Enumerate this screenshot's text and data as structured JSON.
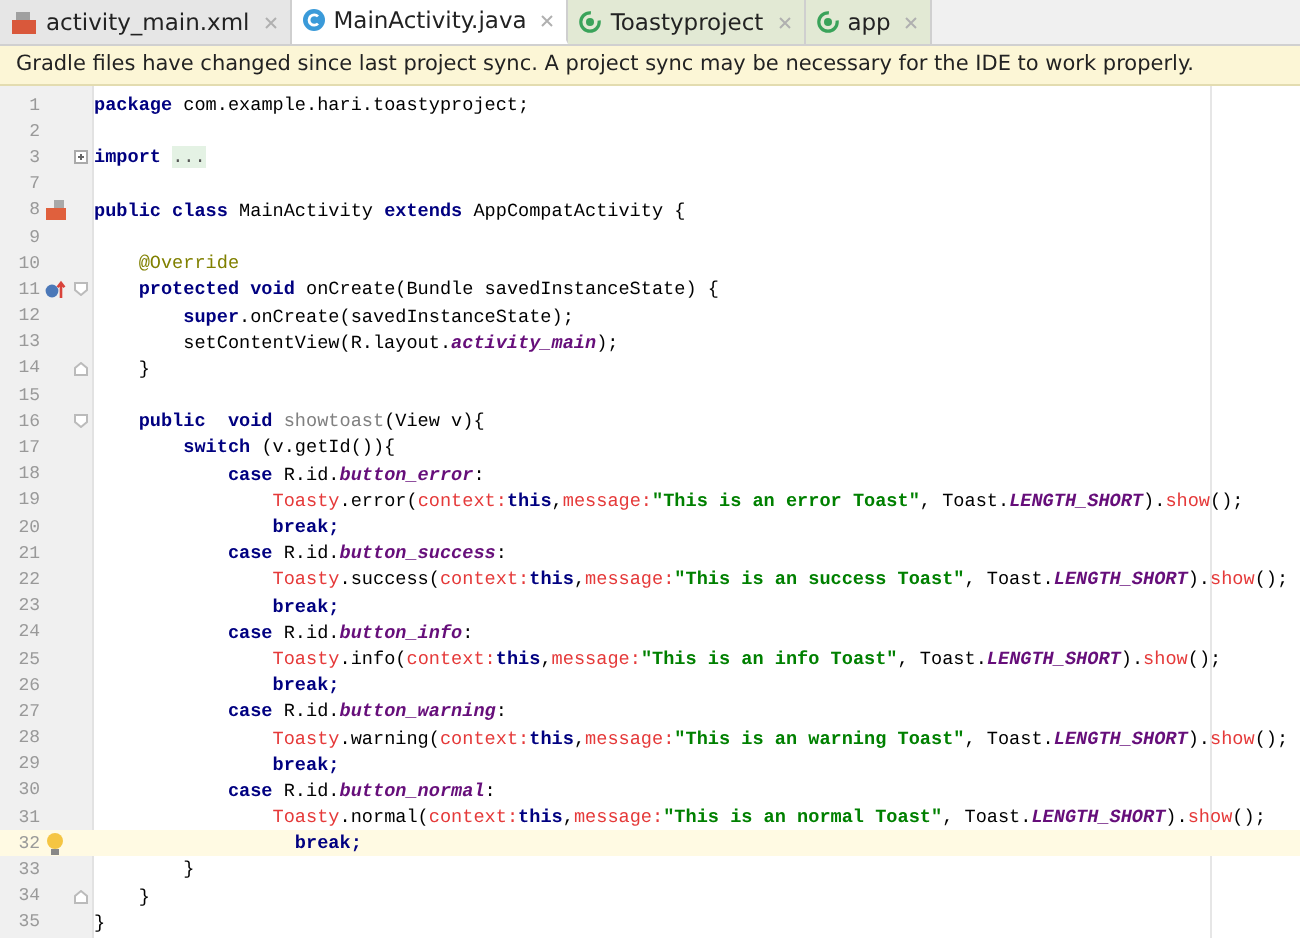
{
  "tabs": [
    {
      "label": "activity_main.xml",
      "kind": "layout",
      "selected": false,
      "color": "#e6e6e6"
    },
    {
      "label": "MainActivity.java",
      "kind": "class",
      "selected": true,
      "color": "#ffffff"
    },
    {
      "label": "Toastyproject",
      "kind": "module",
      "selected": false,
      "color": "#e2e9d4"
    },
    {
      "label": "app",
      "kind": "module",
      "selected": false,
      "color": "#e2e9d4"
    }
  ],
  "banner": {
    "message": "Gradle files have changed since last project sync. A project sync may be necessary for the IDE to work properly."
  },
  "editor": {
    "lines": [
      {
        "number": "1",
        "kind": "plain",
        "tokens": [
          {
            "kind": "kw",
            "text": "package"
          },
          {
            "kind": "text",
            "text": " com.example.hari.toastyproject;"
          }
        ]
      },
      {
        "number": "2",
        "kind": "plain"
      },
      {
        "number": "3",
        "kind": "folded",
        "tokens": [
          {
            "kind": "kw",
            "text": "import "
          },
          {
            "kind": "folded",
            "text": "..."
          }
        ]
      },
      {
        "number": "7",
        "kind": "plain"
      },
      {
        "number": "8",
        "kind": "class",
        "tokens": [
          {
            "kind": "kw",
            "text": "public class"
          },
          {
            "kind": "text",
            "text": " MainActivity "
          },
          {
            "kind": "kw",
            "text": "extends"
          },
          {
            "kind": "text",
            "text": " AppCompatActivity {"
          }
        ]
      },
      {
        "number": "9",
        "kind": "plain"
      },
      {
        "number": "10",
        "kind": "plain",
        "tokens": [
          {
            "kind": "ann",
            "text": "    @Override"
          }
        ]
      },
      {
        "number": "11",
        "kind": "override-fold-start",
        "tokens": [
          {
            "kind": "kw",
            "text": "    protected void"
          },
          {
            "kind": "text",
            "text": " onCreate(Bundle savedInstanceState) {"
          }
        ]
      },
      {
        "number": "12",
        "kind": "plain",
        "tokens": [
          {
            "kind": "kw",
            "text": "        super"
          },
          {
            "kind": "text",
            "text": ".onCreate(savedInstanceState);"
          }
        ]
      },
      {
        "number": "13",
        "kind": "plain",
        "tokens": [
          {
            "kind": "text",
            "text": "        setContentView(R.layout."
          },
          {
            "kind": "const",
            "text": "activity_main"
          },
          {
            "kind": "text",
            "text": ");"
          }
        ]
      },
      {
        "number": "14",
        "kind": "fold-end",
        "tokens": [
          {
            "kind": "text",
            "text": "    }"
          }
        ]
      },
      {
        "number": "15",
        "kind": "plain"
      },
      {
        "number": "16",
        "kind": "fold-start",
        "tokens": [
          {
            "kind": "kw",
            "text": "    public  void "
          },
          {
            "kind": "unused",
            "text": "showtoast"
          },
          {
            "kind": "text",
            "text": "(View v){"
          }
        ]
      },
      {
        "number": "17",
        "kind": "plain",
        "tokens": [
          {
            "kind": "kw",
            "text": "        switch"
          },
          {
            "kind": "text",
            "text": " (v.getId()){"
          }
        ]
      },
      {
        "number": "18",
        "kind": "plain",
        "tokens": [
          {
            "kind": "kw",
            "text": "            case"
          },
          {
            "kind": "text",
            "text": " R.id."
          },
          {
            "kind": "const",
            "text": "button_error"
          },
          {
            "kind": "text",
            "text": ":"
          }
        ]
      },
      {
        "number": "19",
        "kind": "plain",
        "tokens": [
          {
            "kind": "red",
            "text": "                Toasty"
          },
          {
            "kind": "text",
            "text": ".error("
          },
          {
            "kind": "red",
            "text": "context:"
          },
          {
            "kind": "kw",
            "text": "this"
          },
          {
            "kind": "text",
            "text": ","
          },
          {
            "kind": "red",
            "text": "message:"
          },
          {
            "kind": "str",
            "text": "\"This is an error Toast\""
          },
          {
            "kind": "text",
            "text": ", Toast."
          },
          {
            "kind": "const",
            "text": "LENGTH_SHORT"
          },
          {
            "kind": "text",
            "text": ")."
          },
          {
            "kind": "red",
            "text": "show"
          },
          {
            "kind": "text",
            "text": "();"
          }
        ]
      },
      {
        "number": "20",
        "kind": "plain",
        "tokens": [
          {
            "kind": "kw",
            "text": "                break;"
          }
        ]
      },
      {
        "number": "21",
        "kind": "plain",
        "tokens": [
          {
            "kind": "kw",
            "text": "            case"
          },
          {
            "kind": "text",
            "text": " R.id."
          },
          {
            "kind": "const",
            "text": "button_success"
          },
          {
            "kind": "text",
            "text": ":"
          }
        ]
      },
      {
        "number": "22",
        "kind": "plain",
        "tokens": [
          {
            "kind": "red",
            "text": "                Toasty"
          },
          {
            "kind": "text",
            "text": ".success("
          },
          {
            "kind": "red",
            "text": "context:"
          },
          {
            "kind": "kw",
            "text": "this"
          },
          {
            "kind": "text",
            "text": ","
          },
          {
            "kind": "red",
            "text": "message:"
          },
          {
            "kind": "str",
            "text": "\"This is an success Toast\""
          },
          {
            "kind": "text",
            "text": ", Toast."
          },
          {
            "kind": "const",
            "text": "LENGTH_SHORT"
          },
          {
            "kind": "text",
            "text": ")."
          },
          {
            "kind": "red",
            "text": "show"
          },
          {
            "kind": "text",
            "text": "();"
          }
        ]
      },
      {
        "number": "23",
        "kind": "plain",
        "tokens": [
          {
            "kind": "kw",
            "text": "                break;"
          }
        ]
      },
      {
        "number": "24",
        "kind": "plain",
        "tokens": [
          {
            "kind": "kw",
            "text": "            case"
          },
          {
            "kind": "text",
            "text": " R.id."
          },
          {
            "kind": "const",
            "text": "button_info"
          },
          {
            "kind": "text",
            "text": ":"
          }
        ]
      },
      {
        "number": "25",
        "kind": "plain",
        "tokens": [
          {
            "kind": "red",
            "text": "                Toasty"
          },
          {
            "kind": "text",
            "text": ".info("
          },
          {
            "kind": "red",
            "text": "context:"
          },
          {
            "kind": "kw",
            "text": "this"
          },
          {
            "kind": "text",
            "text": ","
          },
          {
            "kind": "red",
            "text": "message:"
          },
          {
            "kind": "str",
            "text": "\"This is an info Toast\""
          },
          {
            "kind": "text",
            "text": ", Toast."
          },
          {
            "kind": "const",
            "text": "LENGTH_SHORT"
          },
          {
            "kind": "text",
            "text": ")."
          },
          {
            "kind": "red",
            "text": "show"
          },
          {
            "kind": "text",
            "text": "();"
          }
        ]
      },
      {
        "number": "26",
        "kind": "plain",
        "tokens": [
          {
            "kind": "kw",
            "text": "                break;"
          }
        ]
      },
      {
        "number": "27",
        "kind": "plain",
        "tokens": [
          {
            "kind": "kw",
            "text": "            case"
          },
          {
            "kind": "text",
            "text": " R.id."
          },
          {
            "kind": "const",
            "text": "button_warning"
          },
          {
            "kind": "text",
            "text": ":"
          }
        ]
      },
      {
        "number": "28",
        "kind": "plain",
        "tokens": [
          {
            "kind": "red",
            "text": "                Toasty"
          },
          {
            "kind": "text",
            "text": ".warning("
          },
          {
            "kind": "red",
            "text": "context:"
          },
          {
            "kind": "kw",
            "text": "this"
          },
          {
            "kind": "text",
            "text": ","
          },
          {
            "kind": "red",
            "text": "message:"
          },
          {
            "kind": "str",
            "text": "\"This is an warning Toast\""
          },
          {
            "kind": "text",
            "text": ", Toast."
          },
          {
            "kind": "const",
            "text": "LENGTH_SHORT"
          },
          {
            "kind": "text",
            "text": ")."
          },
          {
            "kind": "red",
            "text": "show"
          },
          {
            "kind": "text",
            "text": "();"
          }
        ]
      },
      {
        "number": "29",
        "kind": "plain",
        "tokens": [
          {
            "kind": "kw",
            "text": "                break;"
          }
        ]
      },
      {
        "number": "30",
        "kind": "plain",
        "tokens": [
          {
            "kind": "kw",
            "text": "            case"
          },
          {
            "kind": "text",
            "text": " R.id."
          },
          {
            "kind": "const",
            "text": "button_normal"
          },
          {
            "kind": "text",
            "text": ":"
          }
        ]
      },
      {
        "number": "31",
        "kind": "plain",
        "tokens": [
          {
            "kind": "red",
            "text": "                Toasty"
          },
          {
            "kind": "text",
            "text": ".normal("
          },
          {
            "kind": "red",
            "text": "context:"
          },
          {
            "kind": "kw",
            "text": "this"
          },
          {
            "kind": "text",
            "text": ","
          },
          {
            "kind": "red",
            "text": "message:"
          },
          {
            "kind": "str",
            "text": "\"This is an normal Toast\""
          },
          {
            "kind": "text",
            "text": ", Toast."
          },
          {
            "kind": "const",
            "text": "LENGTH_SHORT"
          },
          {
            "kind": "text",
            "text": ")."
          },
          {
            "kind": "red",
            "text": "show"
          },
          {
            "kind": "text",
            "text": "();"
          }
        ]
      },
      {
        "number": "32",
        "kind": "current",
        "tokens": [
          {
            "kind": "kw",
            "text": "                  break;"
          }
        ]
      },
      {
        "number": "33",
        "kind": "plain",
        "tokens": [
          {
            "kind": "text",
            "text": "        }"
          }
        ]
      },
      {
        "number": "34",
        "kind": "fold-end",
        "tokens": [
          {
            "kind": "text",
            "text": "    }"
          }
        ]
      },
      {
        "number": "35",
        "kind": "plain",
        "tokens": [
          {
            "kind": "text",
            "text": "}"
          }
        ]
      }
    ]
  }
}
